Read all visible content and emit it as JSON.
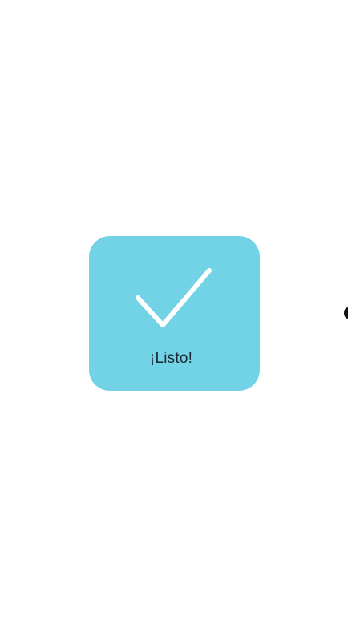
{
  "toast": {
    "message": "¡Listo!",
    "icon": "checkmark-icon",
    "background_color": "#72d3e6",
    "icon_color": "#ffffff",
    "text_color": "#1b2a33"
  }
}
